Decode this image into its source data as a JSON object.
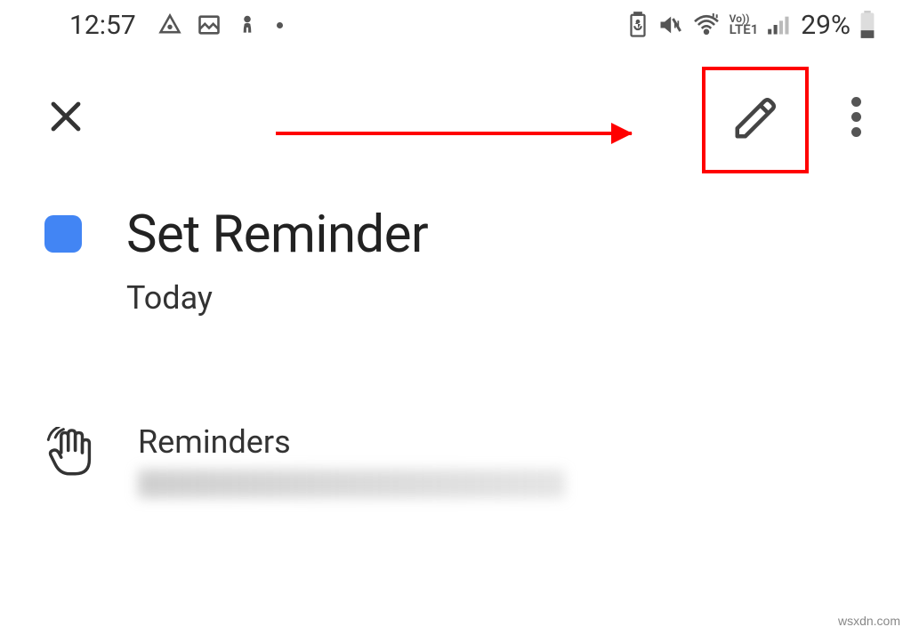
{
  "statusBar": {
    "time": "12:57",
    "batteryPercent": "29%",
    "networkLabel": "LTE1",
    "voLabel": "Vo))"
  },
  "reminder": {
    "title": "Set Reminder",
    "date": "Today"
  },
  "section": {
    "label": "Reminders"
  },
  "annotation": {
    "highlightColor": "#ff0000"
  },
  "watermark": "wsxdn.com"
}
